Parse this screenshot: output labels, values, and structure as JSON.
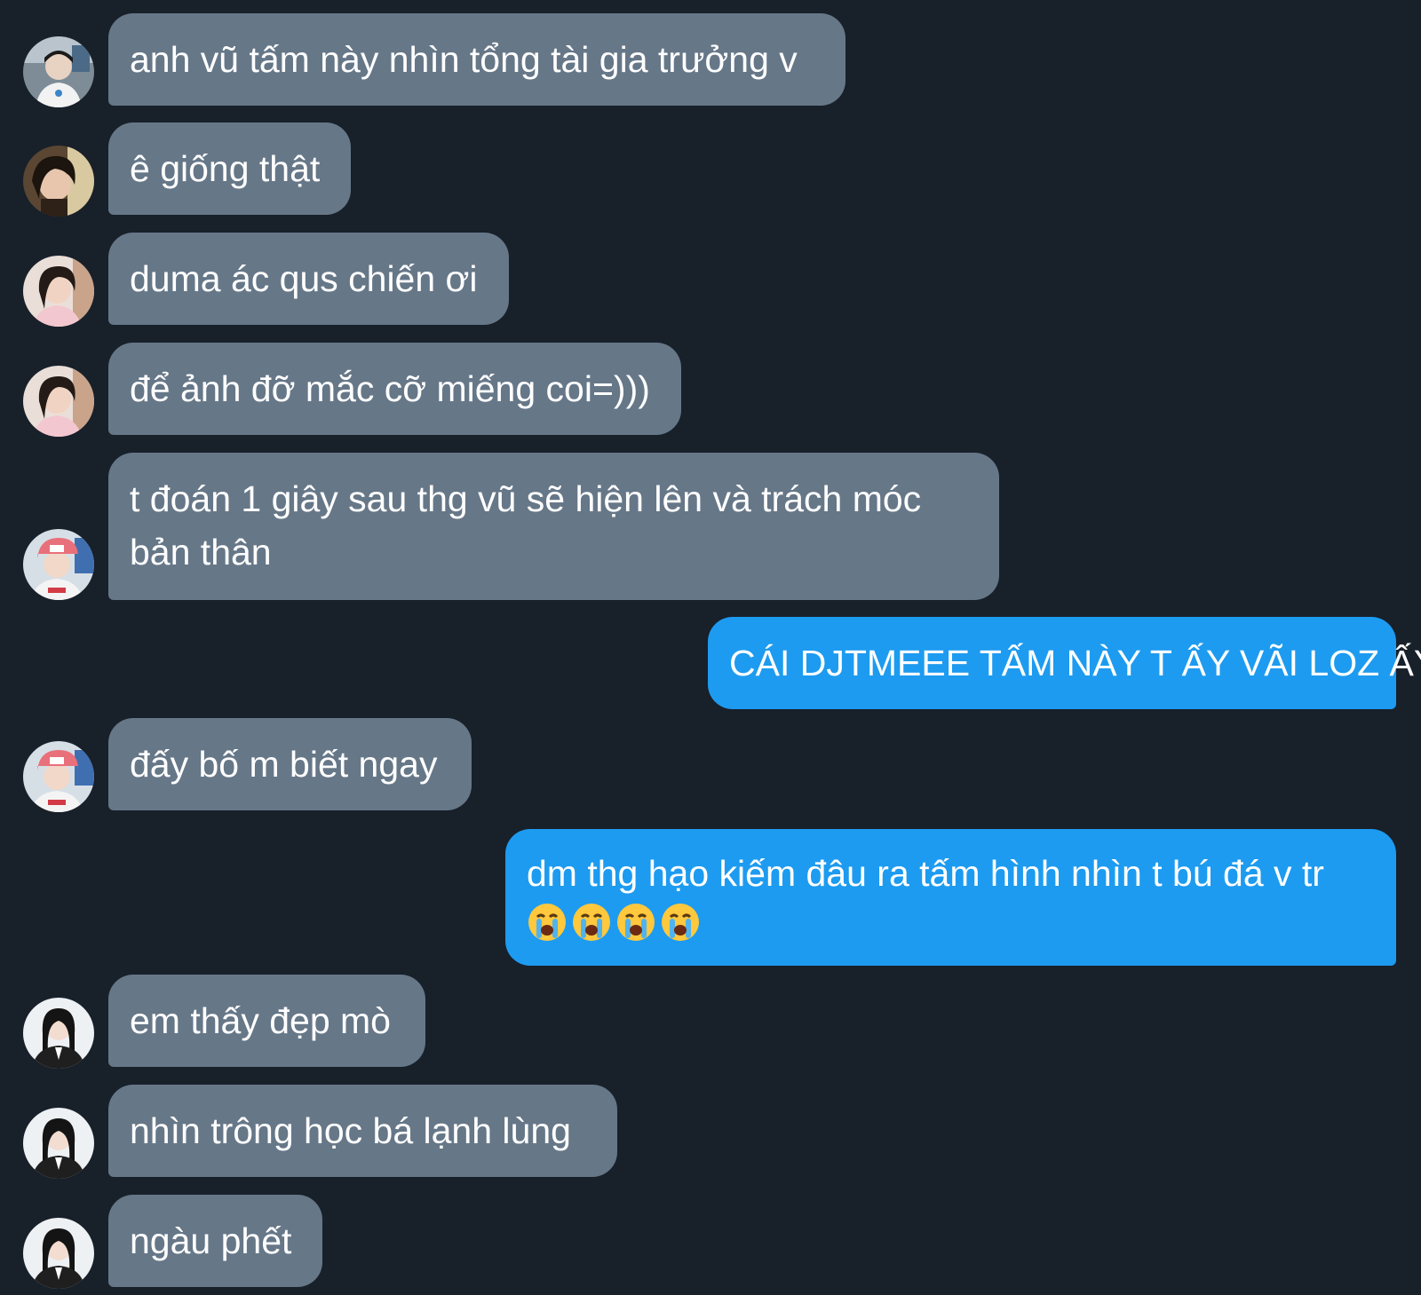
{
  "colors": {
    "background": "#18202a",
    "incoming_bubble": "#667788",
    "outgoing_bubble": "#1d9bf0",
    "text": "#ffffff"
  },
  "messages": [
    {
      "direction": "incoming",
      "avatar": "avatar-boy-white-shirt",
      "lines": [
        "anh vũ tấm này nhìn tổng tài gia trưởng v"
      ]
    },
    {
      "direction": "incoming",
      "avatar": "avatar-girl-dark-hair",
      "lines": [
        "ê giống thật"
      ]
    },
    {
      "direction": "incoming",
      "avatar": "avatar-girl-pink-shirt",
      "lines": [
        "duma ác qus chiến ơi"
      ]
    },
    {
      "direction": "incoming",
      "avatar": "avatar-girl-pink-shirt",
      "lines": [
        "để ảnh đỡ mắc cỡ miếng coi=)))"
      ]
    },
    {
      "direction": "incoming",
      "avatar": "avatar-boy-pink-cap",
      "lines": [
        "t đoán 1 giây sau thg vũ sẽ hiện lên và trách móc",
        "bản thân"
      ]
    },
    {
      "direction": "outgoing",
      "lines": [
        "CÁI DJTMEEE TẤM NÀY T ẤY VÃI LOZ ẤY"
      ]
    },
    {
      "direction": "incoming",
      "avatar": "avatar-boy-pink-cap",
      "lines": [
        "đấy bố m biết ngay"
      ]
    },
    {
      "direction": "outgoing",
      "lines": [
        "dm thg hạo kiếm đâu ra tấm hình nhìn t bú đá v tr"
      ],
      "emojis": [
        "crying-face-icon",
        "crying-face-icon",
        "crying-face-icon",
        "crying-face-icon"
      ]
    },
    {
      "direction": "incoming",
      "avatar": "avatar-girl-black-suit",
      "lines": [
        "em thấy đẹp mò"
      ]
    },
    {
      "direction": "incoming",
      "avatar": "avatar-girl-black-suit",
      "lines": [
        "nhìn trông học bá lạnh lùng"
      ]
    },
    {
      "direction": "incoming",
      "avatar": "avatar-girl-black-suit",
      "lines": [
        "ngàu phết"
      ]
    }
  ]
}
